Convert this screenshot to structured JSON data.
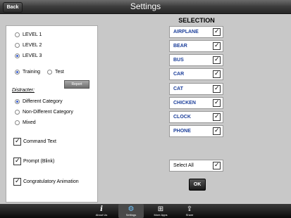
{
  "header": {
    "title": "Settings",
    "back_label": "Back"
  },
  "levels": [
    {
      "label": "LEVEL 1",
      "selected": false
    },
    {
      "label": "LEVEL 2",
      "selected": false
    },
    {
      "label": "LEVEL 3",
      "selected": true
    }
  ],
  "mode": {
    "training_label": "Training",
    "training_selected": true,
    "test_label": "Test",
    "test_selected": false,
    "report_label": "Report"
  },
  "distracter": {
    "heading": "Distracter:",
    "options": [
      {
        "label": "Different Category",
        "selected": true
      },
      {
        "label": "Non-Different Category",
        "selected": false
      },
      {
        "label": "Mixed",
        "selected": false
      }
    ]
  },
  "options": {
    "command_text": "Command Text",
    "prompt_blink": "Prompt (Blink)",
    "congratulatory": "Congratulatory Animation"
  },
  "selection": {
    "title": "SELECTION",
    "items": [
      "AIRPLANE",
      "BEAR",
      "BUS",
      "CAR",
      "CAT",
      "CHICKEN",
      "CLOCK",
      "PHONE"
    ],
    "select_all_label": "Select All",
    "ok_label": "OK"
  },
  "tabbar": {
    "about": "About Us",
    "settings": "Settings",
    "more_apps": "More Apps",
    "share": "Share"
  }
}
